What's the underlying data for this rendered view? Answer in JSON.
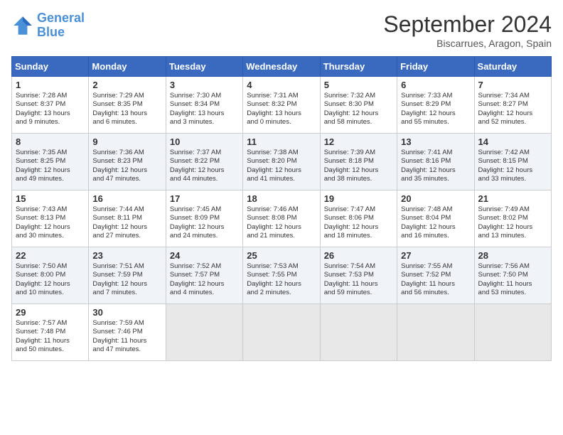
{
  "logo": {
    "line1": "General",
    "line2": "Blue"
  },
  "title": "September 2024",
  "subtitle": "Biscarrues, Aragon, Spain",
  "headers": [
    "Sunday",
    "Monday",
    "Tuesday",
    "Wednesday",
    "Thursday",
    "Friday",
    "Saturday"
  ],
  "weeks": [
    [
      {
        "day": "1",
        "lines": [
          "Sunrise: 7:28 AM",
          "Sunset: 8:37 PM",
          "Daylight: 13 hours",
          "and 9 minutes."
        ]
      },
      {
        "day": "2",
        "lines": [
          "Sunrise: 7:29 AM",
          "Sunset: 8:35 PM",
          "Daylight: 13 hours",
          "and 6 minutes."
        ]
      },
      {
        "day": "3",
        "lines": [
          "Sunrise: 7:30 AM",
          "Sunset: 8:34 PM",
          "Daylight: 13 hours",
          "and 3 minutes."
        ]
      },
      {
        "day": "4",
        "lines": [
          "Sunrise: 7:31 AM",
          "Sunset: 8:32 PM",
          "Daylight: 13 hours",
          "and 0 minutes."
        ]
      },
      {
        "day": "5",
        "lines": [
          "Sunrise: 7:32 AM",
          "Sunset: 8:30 PM",
          "Daylight: 12 hours",
          "and 58 minutes."
        ]
      },
      {
        "day": "6",
        "lines": [
          "Sunrise: 7:33 AM",
          "Sunset: 8:29 PM",
          "Daylight: 12 hours",
          "and 55 minutes."
        ]
      },
      {
        "day": "7",
        "lines": [
          "Sunrise: 7:34 AM",
          "Sunset: 8:27 PM",
          "Daylight: 12 hours",
          "and 52 minutes."
        ]
      }
    ],
    [
      {
        "day": "8",
        "lines": [
          "Sunrise: 7:35 AM",
          "Sunset: 8:25 PM",
          "Daylight: 12 hours",
          "and 49 minutes."
        ]
      },
      {
        "day": "9",
        "lines": [
          "Sunrise: 7:36 AM",
          "Sunset: 8:23 PM",
          "Daylight: 12 hours",
          "and 47 minutes."
        ]
      },
      {
        "day": "10",
        "lines": [
          "Sunrise: 7:37 AM",
          "Sunset: 8:22 PM",
          "Daylight: 12 hours",
          "and 44 minutes."
        ]
      },
      {
        "day": "11",
        "lines": [
          "Sunrise: 7:38 AM",
          "Sunset: 8:20 PM",
          "Daylight: 12 hours",
          "and 41 minutes."
        ]
      },
      {
        "day": "12",
        "lines": [
          "Sunrise: 7:39 AM",
          "Sunset: 8:18 PM",
          "Daylight: 12 hours",
          "and 38 minutes."
        ]
      },
      {
        "day": "13",
        "lines": [
          "Sunrise: 7:41 AM",
          "Sunset: 8:16 PM",
          "Daylight: 12 hours",
          "and 35 minutes."
        ]
      },
      {
        "day": "14",
        "lines": [
          "Sunrise: 7:42 AM",
          "Sunset: 8:15 PM",
          "Daylight: 12 hours",
          "and 33 minutes."
        ]
      }
    ],
    [
      {
        "day": "15",
        "lines": [
          "Sunrise: 7:43 AM",
          "Sunset: 8:13 PM",
          "Daylight: 12 hours",
          "and 30 minutes."
        ]
      },
      {
        "day": "16",
        "lines": [
          "Sunrise: 7:44 AM",
          "Sunset: 8:11 PM",
          "Daylight: 12 hours",
          "and 27 minutes."
        ]
      },
      {
        "day": "17",
        "lines": [
          "Sunrise: 7:45 AM",
          "Sunset: 8:09 PM",
          "Daylight: 12 hours",
          "and 24 minutes."
        ]
      },
      {
        "day": "18",
        "lines": [
          "Sunrise: 7:46 AM",
          "Sunset: 8:08 PM",
          "Daylight: 12 hours",
          "and 21 minutes."
        ]
      },
      {
        "day": "19",
        "lines": [
          "Sunrise: 7:47 AM",
          "Sunset: 8:06 PM",
          "Daylight: 12 hours",
          "and 18 minutes."
        ]
      },
      {
        "day": "20",
        "lines": [
          "Sunrise: 7:48 AM",
          "Sunset: 8:04 PM",
          "Daylight: 12 hours",
          "and 16 minutes."
        ]
      },
      {
        "day": "21",
        "lines": [
          "Sunrise: 7:49 AM",
          "Sunset: 8:02 PM",
          "Daylight: 12 hours",
          "and 13 minutes."
        ]
      }
    ],
    [
      {
        "day": "22",
        "lines": [
          "Sunrise: 7:50 AM",
          "Sunset: 8:00 PM",
          "Daylight: 12 hours",
          "and 10 minutes."
        ]
      },
      {
        "day": "23",
        "lines": [
          "Sunrise: 7:51 AM",
          "Sunset: 7:59 PM",
          "Daylight: 12 hours",
          "and 7 minutes."
        ]
      },
      {
        "day": "24",
        "lines": [
          "Sunrise: 7:52 AM",
          "Sunset: 7:57 PM",
          "Daylight: 12 hours",
          "and 4 minutes."
        ]
      },
      {
        "day": "25",
        "lines": [
          "Sunrise: 7:53 AM",
          "Sunset: 7:55 PM",
          "Daylight: 12 hours",
          "and 2 minutes."
        ]
      },
      {
        "day": "26",
        "lines": [
          "Sunrise: 7:54 AM",
          "Sunset: 7:53 PM",
          "Daylight: 11 hours",
          "and 59 minutes."
        ]
      },
      {
        "day": "27",
        "lines": [
          "Sunrise: 7:55 AM",
          "Sunset: 7:52 PM",
          "Daylight: 11 hours",
          "and 56 minutes."
        ]
      },
      {
        "day": "28",
        "lines": [
          "Sunrise: 7:56 AM",
          "Sunset: 7:50 PM",
          "Daylight: 11 hours",
          "and 53 minutes."
        ]
      }
    ],
    [
      {
        "day": "29",
        "lines": [
          "Sunrise: 7:57 AM",
          "Sunset: 7:48 PM",
          "Daylight: 11 hours",
          "and 50 minutes."
        ]
      },
      {
        "day": "30",
        "lines": [
          "Sunrise: 7:59 AM",
          "Sunset: 7:46 PM",
          "Daylight: 11 hours",
          "and 47 minutes."
        ]
      },
      null,
      null,
      null,
      null,
      null
    ]
  ]
}
